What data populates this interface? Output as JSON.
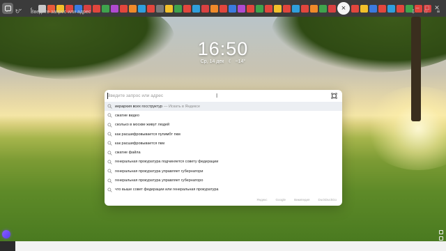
{
  "browser": {
    "address_placeholder": "Введите запрос или адрес",
    "tab_colors": [
      "#c8c8c8",
      "#e85a3a",
      "#f3c02a",
      "#e2463d",
      "#3b7be0",
      "#d94141",
      "#e2463d",
      "#3fa34d",
      "#b04ad1",
      "#e2463d",
      "#f08a2a",
      "#2f9fdd",
      "#e2463d",
      "#7a7a7a",
      "#f3c02a",
      "#3fa34d",
      "#e2463d",
      "#2f9fdd",
      "#d94141",
      "#f08a2a",
      "#e2463d",
      "#3b7be0",
      "#b04ad1",
      "#e2463d",
      "#3fa34d",
      "#e2463d",
      "#f3c02a",
      "#e2463d",
      "#2f9fdd",
      "#e2463d",
      "#f08a2a",
      "#3fa34d",
      "#d94141",
      "#e2463d",
      "#f3c02a",
      "#3b7be0",
      "#e2463d",
      "#2f9fdd",
      "#e2463d",
      "#3fa34d",
      "#e2463d",
      "#d94141"
    ],
    "icons": {
      "logo": "yandex-browser-logo",
      "back": "back-arrow-icon",
      "tab_close": "tab-close-icon",
      "history": "history-icon",
      "reload": "reload-icon",
      "downloads": "downloads-icon",
      "bookmarks": "bookmarks-icon",
      "menu": "menu-icon"
    }
  },
  "clock": {
    "time": "16:50",
    "date": "Ср, 14 дек",
    "weather": "−14°"
  },
  "search": {
    "placeholder": "Введите запрос или адрес",
    "suggestions": [
      {
        "text": "иерархия всех госструктур",
        "hint": "— Искать в Яндексе"
      },
      {
        "text": "сжатие видео",
        "hint": ""
      },
      {
        "text": "сколько в москве живут людей",
        "hint": ""
      },
      {
        "text": "как расшифровывается пупимбт пкм",
        "hint": ""
      },
      {
        "text": "как расшифровывается пкм",
        "hint": ""
      },
      {
        "text": "сжатие файла",
        "hint": ""
      },
      {
        "text": "генеральная прокуратура подчиняется совету федерации",
        "hint": ""
      },
      {
        "text": "генеральная прокуратура управляет губернатори",
        "hint": ""
      },
      {
        "text": "генеральная прокуратура управляет губернаторо",
        "hint": ""
      },
      {
        "text": "что выше совет федерации или генеральная прокуратура",
        "hint": ""
      }
    ],
    "engines": [
      "Яндекс",
      "Google",
      "Википедия",
      "DuckDuckGo"
    ]
  },
  "colors": {
    "accent": "#6a4cff",
    "topbar": "#3b3b3b",
    "panel": "#ffffff"
  }
}
